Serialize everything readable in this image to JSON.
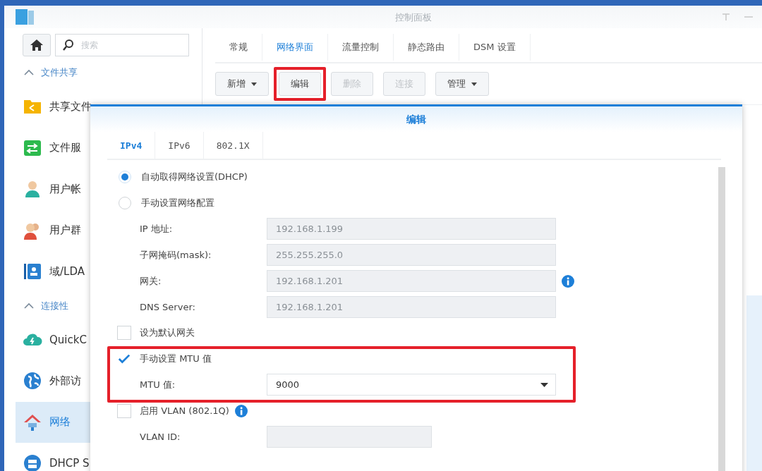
{
  "window": {
    "title": "控制面板"
  },
  "sidebar": {
    "search": {
      "placeholder": "搜索"
    },
    "sections": [
      {
        "title": "文件共享",
        "expanded": true,
        "items": [
          {
            "label": "共享文件",
            "kind": "folder",
            "selected": false
          },
          {
            "label": "文件服",
            "kind": "services",
            "selected": false
          },
          {
            "label": "用户帐",
            "kind": "user",
            "selected": false
          },
          {
            "label": "用户群",
            "kind": "group",
            "selected": false
          },
          {
            "label": "域/LDA",
            "kind": "directory",
            "selected": false
          }
        ]
      },
      {
        "title": "连接性",
        "expanded": true,
        "items": [
          {
            "label": "QuickC",
            "kind": "cloud",
            "selected": false
          },
          {
            "label": "外部访",
            "kind": "globe",
            "selected": false
          },
          {
            "label": "网络",
            "kind": "network",
            "selected": true
          },
          {
            "label": "DHCP S",
            "kind": "dhcp",
            "selected": false
          }
        ]
      }
    ]
  },
  "tabs": [
    {
      "label": "常规",
      "selected": false
    },
    {
      "label": "网络界面",
      "selected": true
    },
    {
      "label": "流量控制",
      "selected": false
    },
    {
      "label": "静态路由",
      "selected": false
    },
    {
      "label": "DSM 设置",
      "selected": false
    }
  ],
  "toolbar": [
    {
      "label": "新增",
      "dropdown": true,
      "disabled": false,
      "highlighted": false
    },
    {
      "label": "编辑",
      "dropdown": false,
      "disabled": false,
      "highlighted": true
    },
    {
      "label": "删除",
      "dropdown": false,
      "disabled": true,
      "highlighted": false
    },
    {
      "label": "连接",
      "dropdown": false,
      "disabled": true,
      "highlighted": false
    },
    {
      "label": "管理",
      "dropdown": true,
      "disabled": false,
      "highlighted": false
    }
  ],
  "dialog": {
    "title": "编辑",
    "tabs": [
      {
        "label": "IPv4",
        "selected": true
      },
      {
        "label": "IPv6",
        "selected": false
      },
      {
        "label": "802.1X",
        "selected": false
      }
    ],
    "network_mode": [
      {
        "label": "自动取得网络设置(DHCP)",
        "selected": true
      },
      {
        "label": "手动设置网络配置",
        "selected": false
      }
    ],
    "groups": [
      {
        "highlighted": false,
        "rows": [
          {
            "kind": "field",
            "label": "IP 地址:",
            "value": "192.168.1.199",
            "disabled": true,
            "info": false
          },
          {
            "kind": "field",
            "label": "子网掩码(mask):",
            "value": "255.255.255.0",
            "disabled": true,
            "info": false
          },
          {
            "kind": "field",
            "label": "网关:",
            "value": "192.168.1.201",
            "disabled": true,
            "info": true
          },
          {
            "kind": "field",
            "label": "DNS Server:",
            "value": "192.168.1.201",
            "disabled": true,
            "info": false
          },
          {
            "kind": "checkbox",
            "label": "设为默认网关",
            "checked": false,
            "info": false
          }
        ]
      },
      {
        "highlighted": true,
        "rows": [
          {
            "kind": "checkbox",
            "label": "手动设置 MTU 值",
            "checked": true,
            "info": false
          },
          {
            "kind": "select",
            "label": "MTU 值:",
            "value": "9000"
          }
        ]
      },
      {
        "highlighted": false,
        "rows": [
          {
            "kind": "checkbox",
            "label": "启用 VLAN (802.1Q)",
            "checked": false,
            "info": true
          },
          {
            "kind": "short-field",
            "label": "VLAN ID:",
            "value": "",
            "disabled": true,
            "info": false
          }
        ]
      }
    ]
  }
}
